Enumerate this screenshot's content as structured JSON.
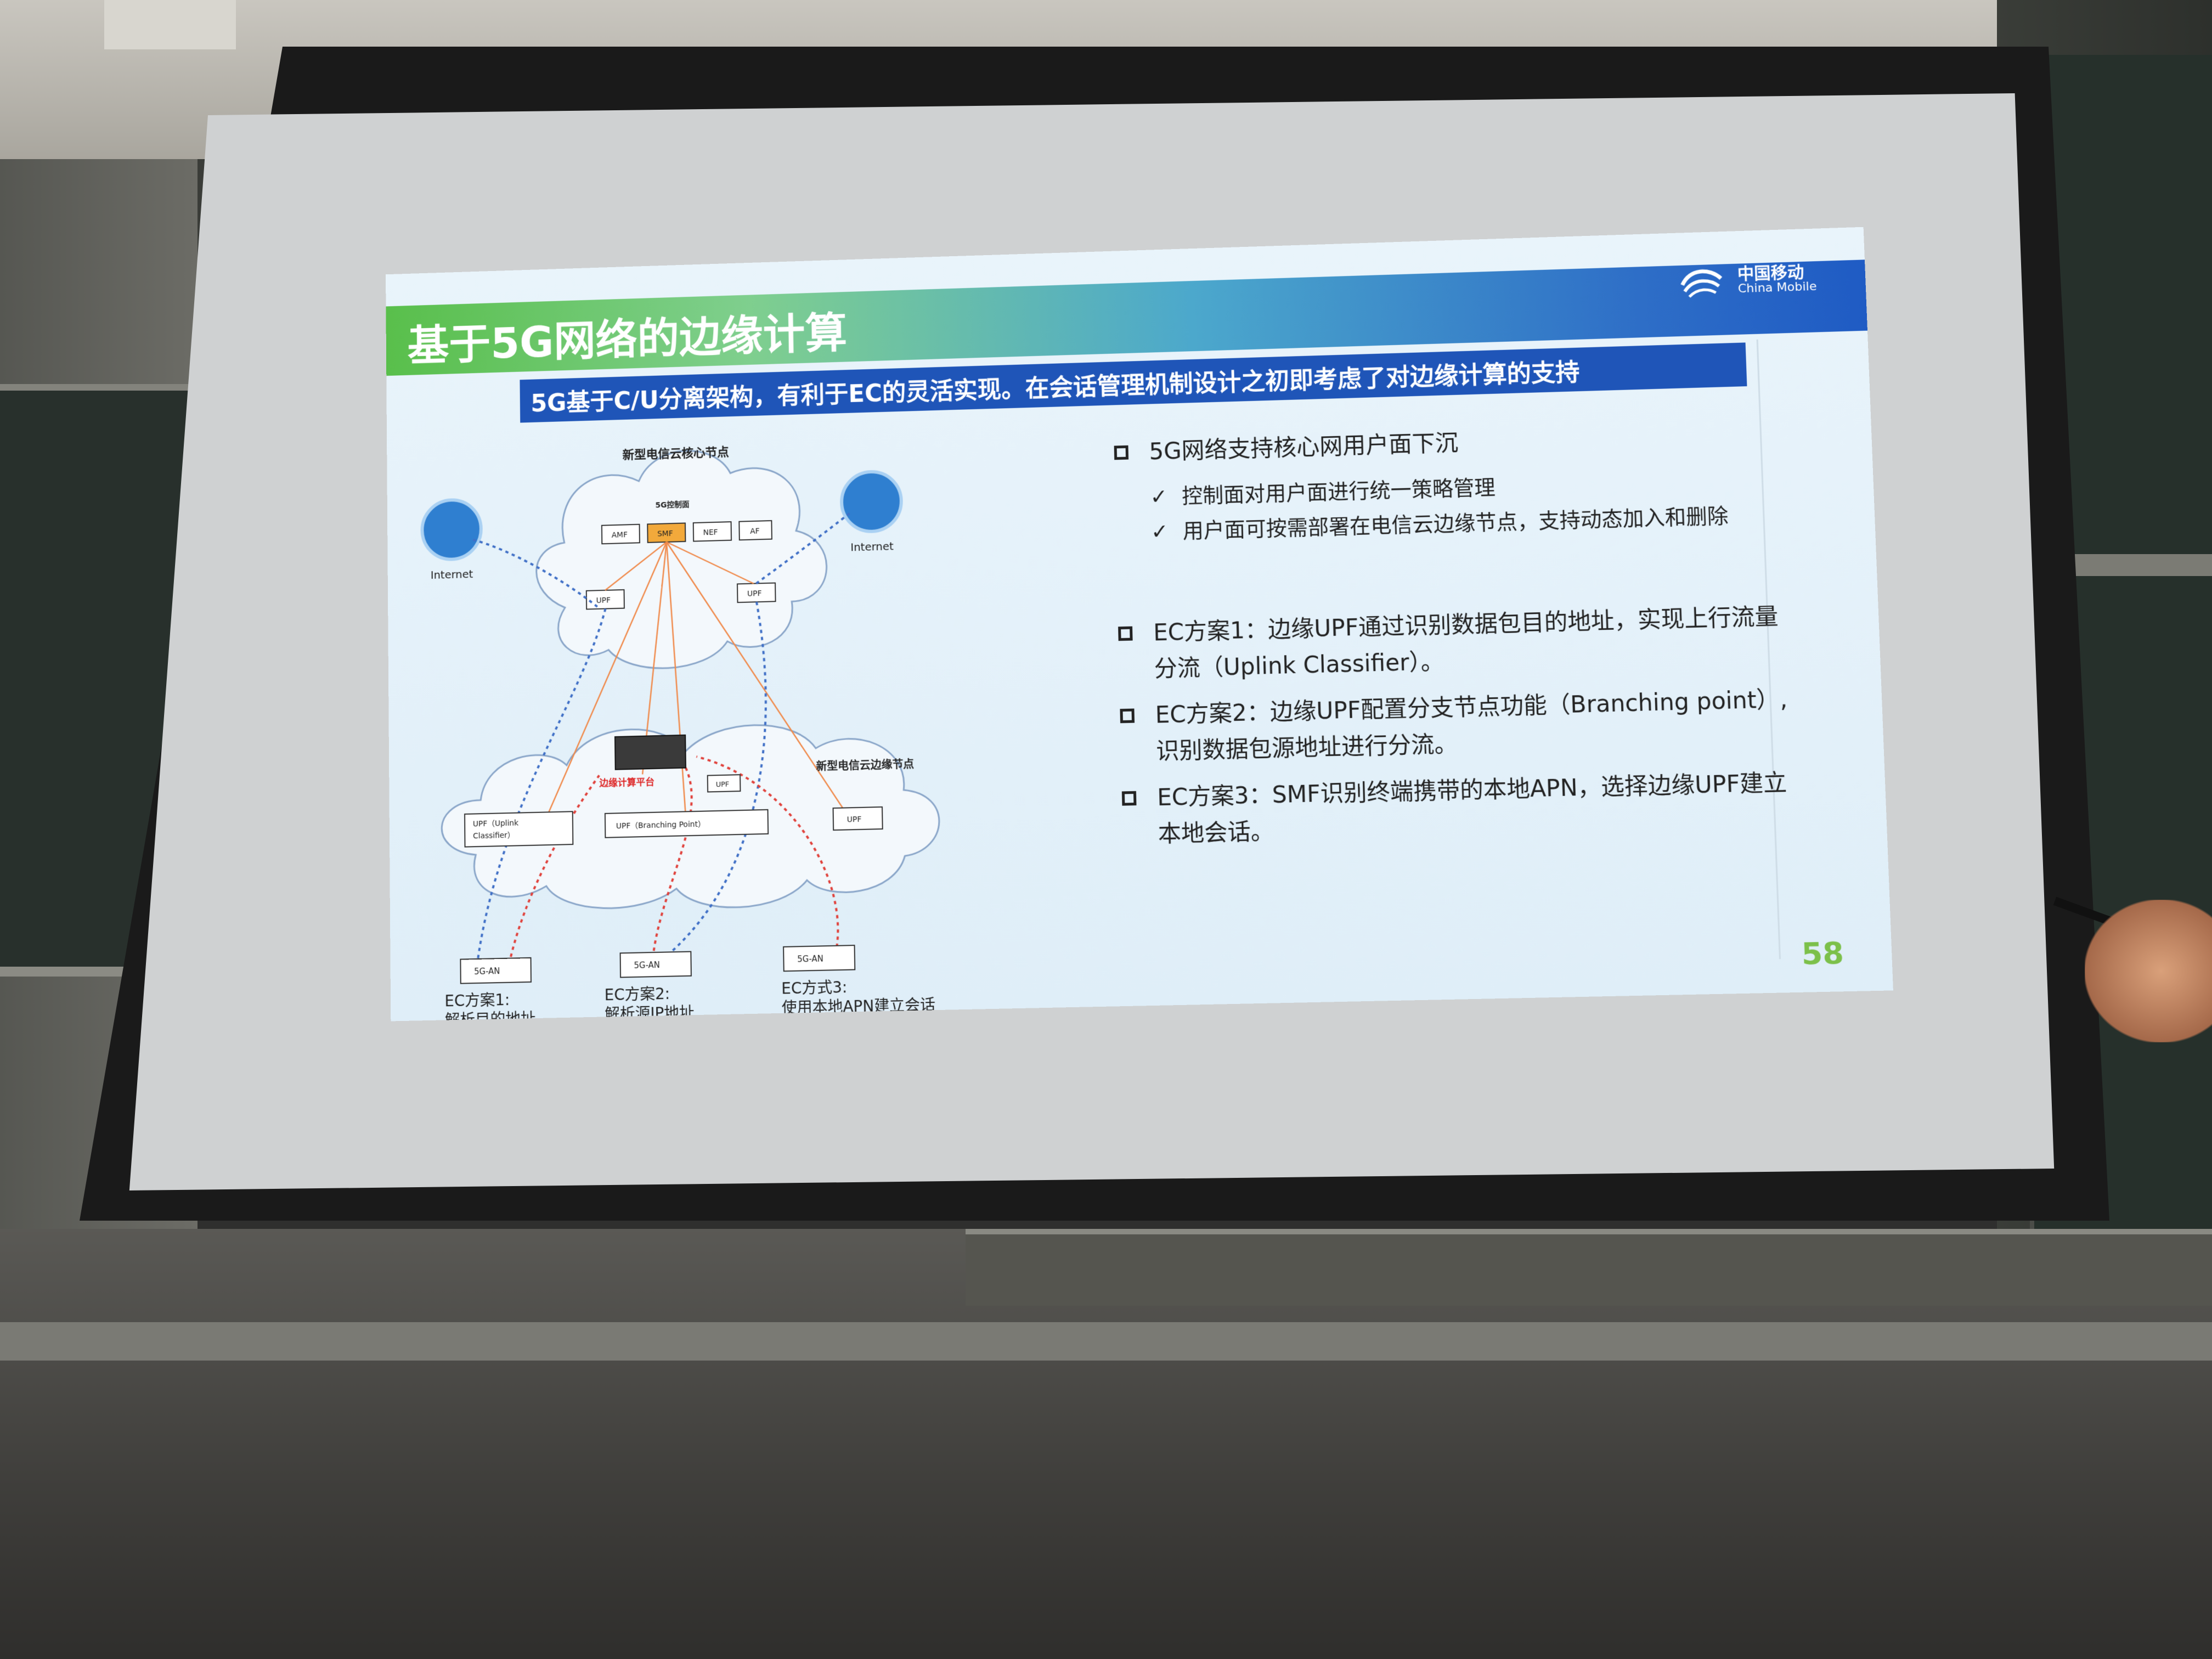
{
  "slide": {
    "title": "基于5G网络的边缘计算",
    "subtitle": "5G基于C/U分离架构，有利于EC的灵活实现。在会话管理机制设计之初即考虑了对边缘计算的支持",
    "logo_cn": "中国移动",
    "logo_en": "China Mobile",
    "page_number": "58",
    "bullets": [
      {
        "text": "5G网络支持核心网用户面下沉",
        "subs": [
          "控制面对用户面进行统一策略管理",
          "用户面可按需部署在电信云边缘节点，支持动态加入和删除"
        ]
      },
      {
        "text": "EC方案1：边缘UPF通过识别数据包目的地址，实现上行流量分流（Uplink Classifier）。",
        "subs": []
      },
      {
        "text": "EC方案2：边缘UPF配置分支节点功能（Branching point）,识别数据包源地址进行分流。",
        "subs": []
      },
      {
        "text": "EC方案3：SMF识别终端携带的本地APN，选择边缘UPF建立本地会话。",
        "subs": []
      }
    ],
    "check_mark": "✓"
  },
  "diagram": {
    "core_cloud_label": "新型电信云核心节点",
    "control_label": "5G控制面",
    "nf": [
      "AMF",
      "SMF",
      "NEF",
      "AF"
    ],
    "upf": "UPF",
    "internet": "Internet",
    "edge_cloud_label": "新型电信云边缘节点",
    "edge_platform": "边缘计算平台",
    "upf_uplink_1": "UPF（Uplink",
    "upf_uplink_2": "Classifier）",
    "upf_branching": "UPF（Branching Point）",
    "an": "5G-AN",
    "captions": [
      {
        "l1": "EC方案1:",
        "l2": "解析目的地址"
      },
      {
        "l1": "EC方案2:",
        "l2": "解析源IP地址"
      },
      {
        "l1": "EC方式3:",
        "l2": "使用本地APN建立会话"
      }
    ],
    "colors": {
      "smf": "#f2a93b",
      "blue_path": "#3f6fc6",
      "red_path": "#e0413b",
      "orange_line": "#f08a4b"
    }
  }
}
